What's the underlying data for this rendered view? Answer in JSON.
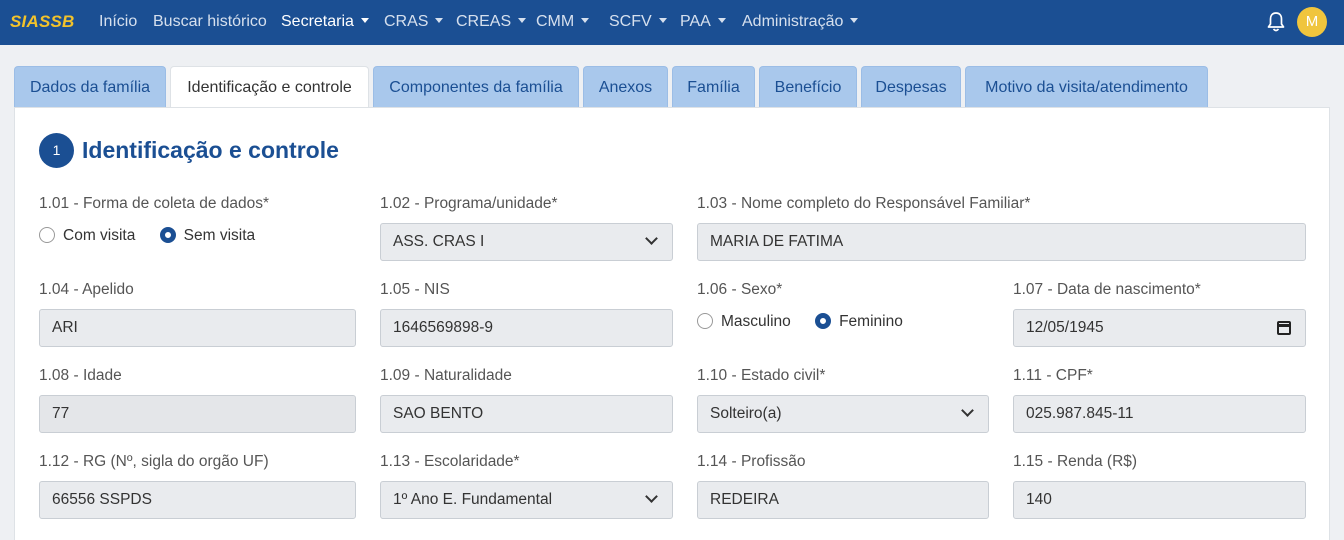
{
  "nav": {
    "brand": "SIASSB",
    "items": [
      {
        "label": "Início"
      },
      {
        "label": "Buscar histórico"
      },
      {
        "label": "Secretaria"
      },
      {
        "label": "CRAS"
      },
      {
        "label": "CREAS"
      },
      {
        "label": "CMM"
      },
      {
        "label": "SCFV"
      },
      {
        "label": "PAA"
      },
      {
        "label": "Administração"
      }
    ],
    "avatar_initial": "M"
  },
  "tabs": [
    {
      "label": "Dados da família"
    },
    {
      "label": "Identificação e controle"
    },
    {
      "label": "Componentes da família"
    },
    {
      "label": "Anexos"
    },
    {
      "label": "Família"
    },
    {
      "label": "Benefício"
    },
    {
      "label": "Despesas"
    },
    {
      "label": "Motivo da visita/atendimento"
    }
  ],
  "section": {
    "number": "1",
    "title": "Identificação e controle"
  },
  "fields": {
    "f101": {
      "label": "1.01 - Forma de coleta de dados*",
      "options": [
        "Com visita",
        "Sem visita"
      ],
      "selected": "Sem visita"
    },
    "f102": {
      "label": "1.02 - Programa/unidade*",
      "value": "ASS. CRAS I"
    },
    "f103": {
      "label": "1.03 - Nome completo do Responsável Familiar*",
      "value": "MARIA DE FATIMA"
    },
    "f104": {
      "label": "1.04 - Apelido",
      "value": "ARI"
    },
    "f105": {
      "label": "1.05 - NIS",
      "value": "1646569898-9"
    },
    "f106": {
      "label": "1.06 - Sexo*",
      "options": [
        "Masculino",
        "Feminino"
      ],
      "selected": "Feminino"
    },
    "f107": {
      "label": "1.07 - Data de nascimento*",
      "value": "12/05/1945"
    },
    "f108": {
      "label": "1.08 - Idade",
      "value": "77"
    },
    "f109": {
      "label": "1.09 - Naturalidade",
      "value": "SAO BENTO"
    },
    "f110": {
      "label": "1.10 - Estado civil*",
      "value": "Solteiro(a)"
    },
    "f111": {
      "label": "1.11 - CPF*",
      "value": "025.987.845-11"
    },
    "f112": {
      "label": "1.12 - RG (Nº, sigla do orgão UF)",
      "value": "66556 SSPDS"
    },
    "f113": {
      "label": "1.13 - Escolaridade*",
      "value": "1º Ano E. Fundamental"
    },
    "f114": {
      "label": "1.14 - Profissão",
      "value": "REDEIRA"
    },
    "f115": {
      "label": "1.15 - Renda (R$)",
      "value": "140"
    }
  },
  "colors": {
    "primary": "#1b4f93",
    "brand": "#f3c32b",
    "tab_inactive": "#a9c8ec"
  }
}
